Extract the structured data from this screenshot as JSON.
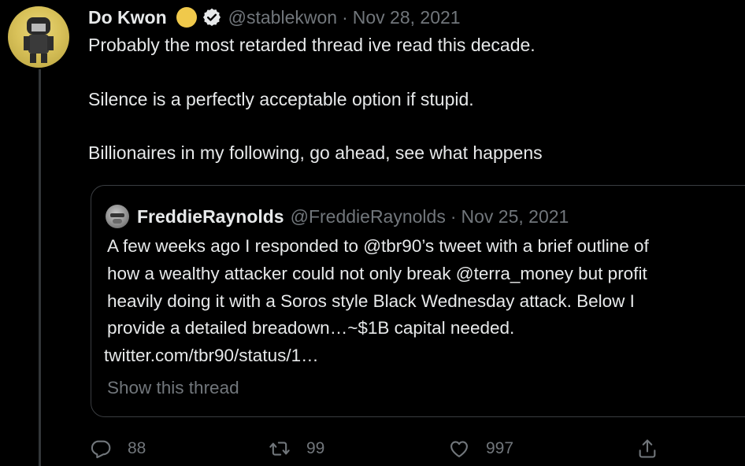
{
  "tweet": {
    "display_name": "Do Kwon",
    "handle": "@stablekwon",
    "separator": "·",
    "date": "Nov 28, 2021",
    "lines": [
      "Probably the most retarded thread ive read this decade.",
      "Silence is a perfectly acceptable option if stupid.",
      "Billionaires in my following, go ahead, see what happens"
    ]
  },
  "quote": {
    "display_name": "FreddieRaynolds",
    "handle": "@FreddieRaynolds",
    "separator": "·",
    "date": "Nov 25, 2021",
    "lines": [
      "A few weeks ago I responded to @tbr90’s tweet with a brief outline of",
      "how a wealthy attacker could not only break @terra_money but profit",
      "heavily doing it with a Soros style Black Wednesday attack. Below I",
      "provide a detailed breadown…~$1B capital needed.",
      "twitter.com/tbr90/status/1…"
    ],
    "show_thread": "Show this thread"
  },
  "actions": {
    "reply_count": "88",
    "retweet_count": "99",
    "like_count": "997"
  },
  "icons": {
    "gold_badge": "gold-circle-badge-icon",
    "verified": "verified-check-icon",
    "reply": "reply-icon",
    "retweet": "retweet-icon",
    "like": "heart-icon",
    "share": "share-icon"
  },
  "colors": {
    "background": "#000000",
    "primary_text": "#e7e9ea",
    "secondary_text": "#71767b",
    "border": "#3a3d41",
    "gold_badge": "#f0c94b"
  }
}
